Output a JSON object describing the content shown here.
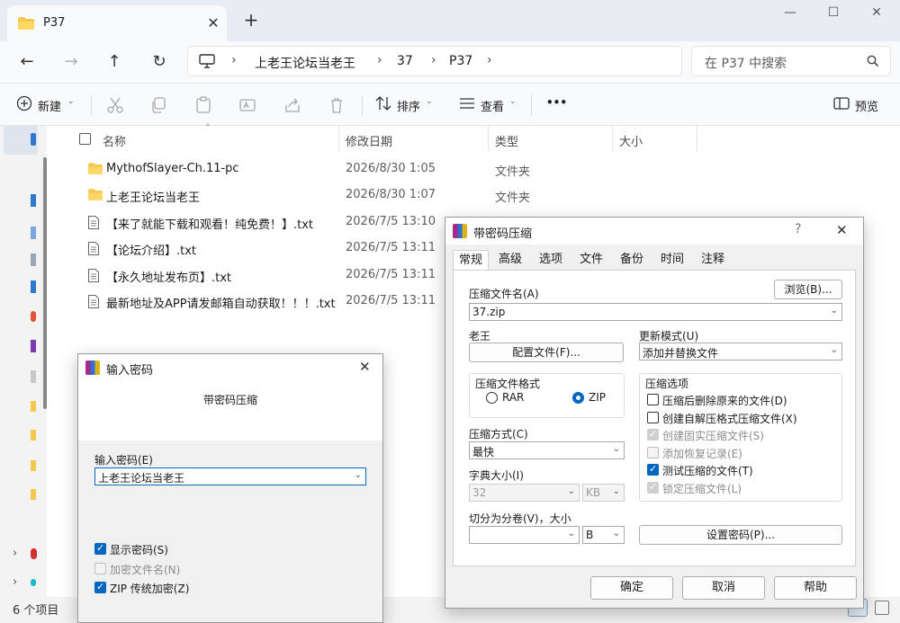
{
  "explorer": {
    "tab_title": "P37",
    "window_controls": {
      "minimize": "—",
      "maximize": "☐",
      "close": "✕"
    },
    "tab_close": "✕",
    "tab_add": "+",
    "breadcrumb": [
      "上老王论坛当老王",
      "37",
      "P37"
    ],
    "search_placeholder": "在 P37 中搜索",
    "toolbar": {
      "new": "新建",
      "sort": "排序",
      "view": "查看",
      "more": "•••",
      "preview": "预览"
    },
    "columns": {
      "name": "名称",
      "date": "修改日期",
      "type": "类型",
      "size": "大小"
    },
    "files": [
      {
        "icon": "folder",
        "name": "MythofSlayer-Ch.11-pc",
        "date": "2026/8/30 1:05",
        "type": "文件夹"
      },
      {
        "icon": "folder",
        "name": "上老王论坛当老王",
        "date": "2026/8/30 1:07",
        "type": "文件夹"
      },
      {
        "icon": "txt",
        "name": "【来了就能下载和观看！纯免费！】.txt",
        "date": "2026/7/5 13:10",
        "type": ""
      },
      {
        "icon": "txt",
        "name": "【论坛介绍】.txt",
        "date": "2026/7/5 13:11",
        "type": ""
      },
      {
        "icon": "txt",
        "name": "【永久地址发布页】.txt",
        "date": "2026/7/5 13:11",
        "type": ""
      },
      {
        "icon": "txt",
        "name": "最新地址及APP请发邮箱自动获取！！！.txt",
        "date": "2026/7/5 13:11",
        "type": ""
      }
    ],
    "status_count": "6 个项目"
  },
  "password_dialog": {
    "title": "输入密码",
    "subtitle": "带密码压缩",
    "input_label": "输入密码(E)",
    "input_value": "上老王论坛当老王",
    "show_password": "显示密码(S)",
    "encrypt_names": "加密文件名(N)",
    "zip_legacy": "ZIP 传统加密(Z)"
  },
  "archive_dialog": {
    "title": "带密码压缩",
    "help_glyph": "?",
    "close_glyph": "✕",
    "tabs": [
      "常规",
      "高级",
      "选项",
      "文件",
      "备份",
      "时间",
      "注释"
    ],
    "archive_name_label": "压缩文件名(A)",
    "archive_name_value": "37.zip",
    "browse_button": "浏览(B)...",
    "profile_label": "老王",
    "profile_button": "配置文件(F)...",
    "update_mode_label": "更新模式(U)",
    "update_mode_value": "添加并替换文件",
    "format_group": "压缩文件格式",
    "format_rar": "RAR",
    "format_zip": "ZIP",
    "options_group": "压缩选项",
    "opt_delete": "压缩后删除原来的文件(D)",
    "opt_sfx": "创建自解压格式压缩文件(X)",
    "opt_solid": "创建固实压缩文件(S)",
    "opt_recovery": "添加恢复记录(E)",
    "opt_test": "测试压缩的文件(T)",
    "opt_lock": "锁定压缩文件(L)",
    "method_label": "压缩方式(C)",
    "method_value": "最快",
    "dict_label": "字典大小(I)",
    "dict_value": "32",
    "dict_unit": "KB",
    "split_label": "切分为分卷(V)，大小",
    "split_unit": "B",
    "set_password_button": "设置密码(P)...",
    "ok_button": "确定",
    "cancel_button": "取消",
    "help_button": "帮助"
  }
}
